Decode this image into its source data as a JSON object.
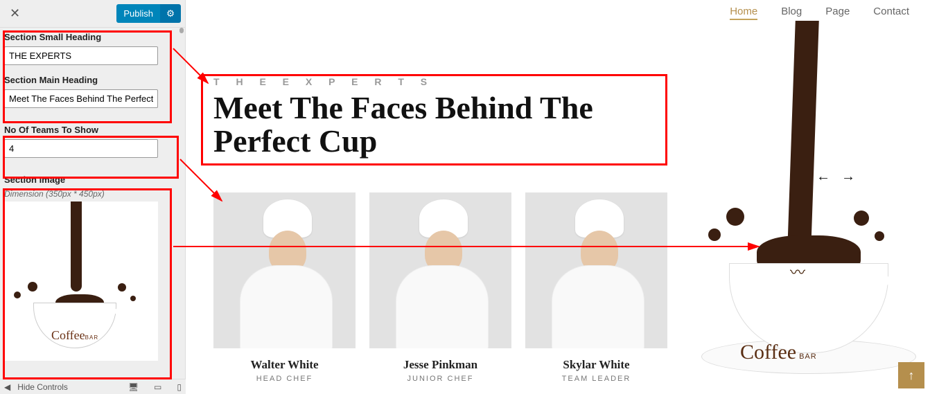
{
  "sidebar": {
    "publish_label": "Publish",
    "fields": {
      "small_heading_label": "Section Small Heading",
      "small_heading_value": "THE EXPERTS",
      "main_heading_label": "Section Main Heading",
      "main_heading_value": "Meet The Faces Behind The Perfect Cu",
      "teams_label": "No Of Teams To Show",
      "teams_value": "4",
      "image_label": "Section Image",
      "image_hint": "Dimension (350px * 450px)"
    },
    "hide_controls": "Hide Controls"
  },
  "nav": {
    "items": [
      {
        "label": "Home",
        "active": true
      },
      {
        "label": "Blog",
        "active": false
      },
      {
        "label": "Page",
        "active": false
      },
      {
        "label": "Contact",
        "active": false
      }
    ]
  },
  "hero": {
    "small": "T H E   E X P E R T S",
    "main": "Meet The Faces Behind The Perfect Cup"
  },
  "team": [
    {
      "name": "Walter White",
      "role": "HEAD CHEF"
    },
    {
      "name": "Jesse Pinkman",
      "role": "JUNIOR CHEF"
    },
    {
      "name": "Skylar White",
      "role": "TEAM LEADER"
    }
  ],
  "logo": {
    "text": "Coffee",
    "sub": "BAR"
  },
  "icons": {
    "gear": "⚙",
    "pencil": "✎",
    "close": "✕",
    "left": "←",
    "right": "→",
    "collapse": "◀",
    "desktop": "🖥",
    "tablet": "▭",
    "mobile": "▯",
    "up": "↑"
  }
}
